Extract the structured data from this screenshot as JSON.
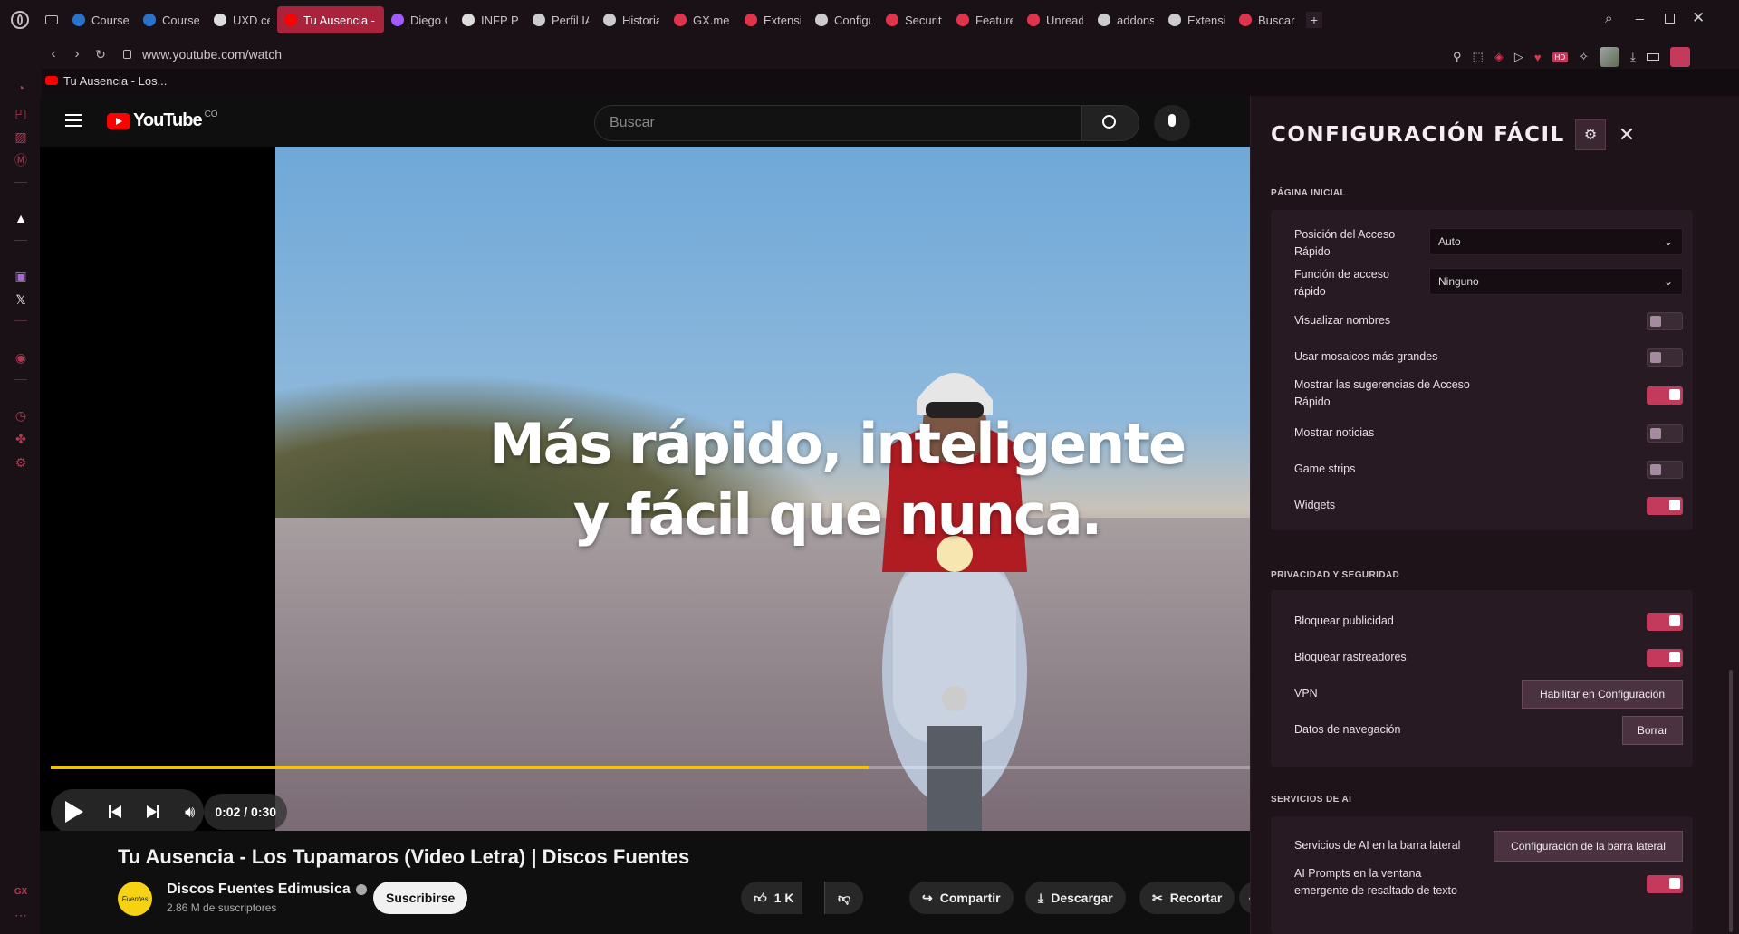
{
  "tabs": [
    {
      "label": "Coursera",
      "icon": "coursera-icon",
      "color": "#2a73cc"
    },
    {
      "label": "Coursera",
      "icon": "coursera-icon",
      "color": "#2a73cc"
    },
    {
      "label": "UXD cert",
      "icon": "document-icon",
      "color": "#dddddd"
    },
    {
      "label": "Tu Ausencia - Lo",
      "icon": "youtube-icon",
      "color": "#ff0000",
      "active": true
    },
    {
      "label": "Diego Ca",
      "icon": "figma-icon",
      "color": "#a259ff"
    },
    {
      "label": "INFP Per",
      "icon": "document-icon",
      "color": "#dddddd"
    },
    {
      "label": "Perfil IA",
      "icon": "openai-icon",
      "color": "#cccccc"
    },
    {
      "label": "Historial",
      "icon": "clock-icon",
      "color": "#cccccc"
    },
    {
      "label": "GX.me -",
      "icon": "gx-icon",
      "color": "#e0334c"
    },
    {
      "label": "Extensio",
      "icon": "opera-icon",
      "color": "#e0334c"
    },
    {
      "label": "Configur",
      "icon": "gear-icon",
      "color": "#cccccc"
    },
    {
      "label": "Security",
      "icon": "opera-icon",
      "color": "#e0334c"
    },
    {
      "label": "Features",
      "icon": "opera-icon",
      "color": "#e0334c"
    },
    {
      "label": "Unread",
      "icon": "opera-icon",
      "color": "#e0334c"
    },
    {
      "label": "addons.c",
      "icon": "globe-icon",
      "color": "#cccccc"
    },
    {
      "label": "Extensio",
      "icon": "cube-icon",
      "color": "#cccccc"
    },
    {
      "label": "Buscar -",
      "icon": "opera-icon",
      "color": "#e0334c"
    }
  ],
  "address": {
    "url": "www.youtube.com/watch"
  },
  "pinned_tab": {
    "label": "Tu Ausencia - Los..."
  },
  "youtube": {
    "logo_text": "YouTube",
    "country": "CO",
    "search_placeholder": "Buscar",
    "overlay_line1": "Más rápido, inteligente",
    "overlay_line2": "y fácil que nunca.",
    "time": "0:02 / 0:30",
    "progress": 0.68,
    "video_title": "Tu Ausencia - Los Tupamaros (Video Letra) | Discos Fuentes",
    "channel": "Discos Fuentes Edimusica",
    "subscribers": "2.86 M de suscriptores",
    "subscribe": "Suscribirse",
    "likes": "1 K",
    "share": "Compartir",
    "download": "Descargar",
    "clip": "Recortar",
    "avatar_text": "Fuentes"
  },
  "panel": {
    "title": "CONFIGURACIÓN FÁCIL",
    "sections": {
      "home": "PÁGINA INICIAL",
      "privacy": "PRIVACIDAD Y SEGURIDAD",
      "ai": "SERVICIOS DE AI"
    },
    "home": {
      "speed_dial_position": {
        "label_1": "Posición del Acceso",
        "label_2": "Rápido",
        "value": "Auto"
      },
      "speed_dial_function": {
        "label_1": "Función de acceso",
        "label_2": "rápido",
        "value": "Ninguno"
      },
      "show_names": {
        "label": "Visualizar nombres",
        "on": false
      },
      "bigger_tiles": {
        "label": "Usar mosaicos más grandes",
        "on": false
      },
      "suggestions": {
        "label_1": "Mostrar las sugerencias de Acceso",
        "label_2": "Rápido",
        "on": true
      },
      "news": {
        "label": "Mostrar noticias",
        "on": false
      },
      "game_strips": {
        "label": "Game strips",
        "on": false
      },
      "widgets": {
        "label": "Widgets",
        "on": true
      }
    },
    "privacy": {
      "block_ads": {
        "label": "Bloquear publicidad",
        "on": true
      },
      "block_trackers": {
        "label": "Bloquear rastreadores",
        "on": true
      },
      "vpn": {
        "label": "VPN",
        "button": "Habilitar en Configuración"
      },
      "browsing_data": {
        "label": "Datos de navegación",
        "button": "Borrar"
      }
    },
    "ai": {
      "sidebar": {
        "label": "Servicios de AI en la barra lateral",
        "button": "Configuración de la barra lateral"
      },
      "prompts": {
        "label_1": "AI Prompts en la ventana",
        "label_2": "emergente de resaltado de texto",
        "on": true
      }
    }
  },
  "colors": {
    "accent": "#c43a5c",
    "active_tab": "#a8233b",
    "youtube_progress": "#f4c20d"
  }
}
